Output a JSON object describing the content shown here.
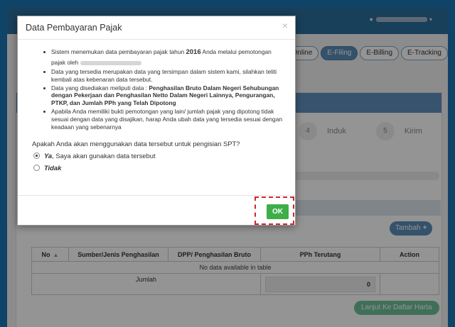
{
  "header": {
    "user_name": "",
    "caret": "▾"
  },
  "tabs": [
    {
      "label": "P Online",
      "active": false
    },
    {
      "label": "E-Filing",
      "active": true
    },
    {
      "label": "E-Billing",
      "active": false
    },
    {
      "label": "E-Tracking",
      "active": false
    }
  ],
  "steps": [
    {
      "number": "4",
      "label": "Induk"
    },
    {
      "number": "5",
      "label": "Kirim"
    }
  ],
  "buttons": {
    "add": "Tambah",
    "add_icon": "+",
    "next": "Lanjut Ke Daftar Harta"
  },
  "table": {
    "headers": [
      "No",
      "Sumber/Jenis Penghasilan",
      "DPP/ Penghasilan Bruto",
      "PPh Terutang",
      "Action"
    ],
    "empty_text": "No data available in table",
    "total_label": "Jumlah",
    "total_value": "0"
  },
  "modal": {
    "title": "Data Pembayaran Pajak",
    "close": "×",
    "b1_pre": "Sistem menemukan data pembayaran pajak tahun ",
    "b1_year": "2016",
    "b1_post": " Anda melalui pemotongan pajak oleh",
    "b2": "Data yang tersedia merupakan data yang tersimpan dalam sistem kami, silahkan teliti kembali atas kebenaran data tersebut.",
    "b3_pre": "Data yang disediakan meliputi data : ",
    "b3_bold": "Penghasilan Bruto Dalam Negeri Sehubungan dengan Pekerjaan dan Penghasilan Netto Dalam Negeri Lainnya, Pengurangan, PTKP, dan Jumlah PPh yang Telah Dipotong",
    "b4": "Apabila Anda memiliki bukti pemotongan yang lain/ jumlah pajak yang dipotong tidak sesuai dengan data yang disajikan, harap Anda ubah data yang tersedia sesuai dengan keadaan yang sebenarnya",
    "question": "Apakah Anda akan menggunakan data tersebut untuk pengisian SPT?",
    "option_yes_bold": "Ya",
    "option_yes_rest": ", Saya akan gunakan data tersebut",
    "option_no": "Tidak",
    "ok_label": "OK"
  },
  "colors": {
    "frame": "#1b75b3",
    "ok": "#3fae49",
    "highlight": "#d0262a",
    "tab_active": "#5b8db8"
  }
}
